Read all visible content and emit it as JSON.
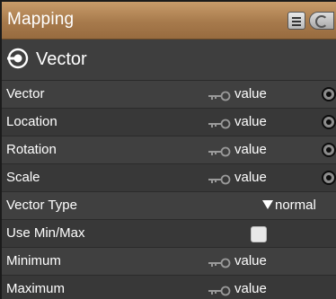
{
  "header": {
    "title": "Mapping",
    "list_icon": "list-icon",
    "cycle_icon": "cycle-icon"
  },
  "output": {
    "label": "Vector",
    "icon": "output-socket-icon"
  },
  "rows": [
    {
      "label": "Vector",
      "kind": "value",
      "value": "value",
      "socket": true
    },
    {
      "label": "Location",
      "kind": "value",
      "value": "value",
      "socket": true
    },
    {
      "label": "Rotation",
      "kind": "value",
      "value": "value",
      "socket": true
    },
    {
      "label": "Scale",
      "kind": "value",
      "value": "value",
      "socket": true
    },
    {
      "label": "Vector Type",
      "kind": "dropdown",
      "value": "normal"
    },
    {
      "label": "Use Min/Max",
      "kind": "checkbox",
      "checked": false
    },
    {
      "label": "Minimum",
      "kind": "value",
      "value": "value",
      "socket": false
    },
    {
      "label": "Maximum",
      "kind": "value",
      "value": "value",
      "socket": false
    }
  ],
  "colors": {
    "header": "#a77a4c",
    "body": "#3a3a3a",
    "text": "#ffffff"
  }
}
